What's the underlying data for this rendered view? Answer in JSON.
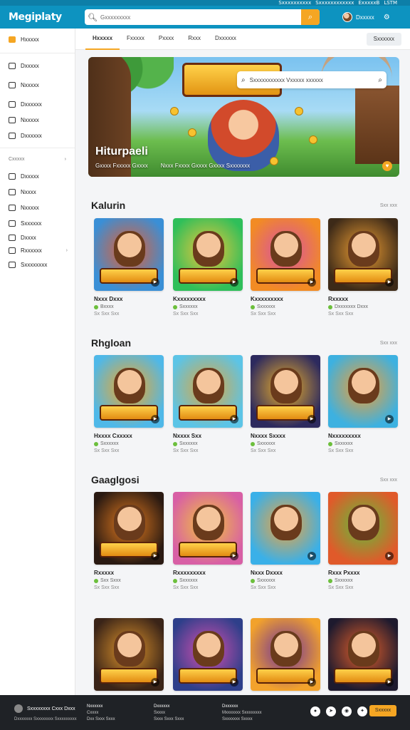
{
  "status": {
    "items": [
      "Sxxxxxxxxxx",
      "Sxxxxxxxxxxxx",
      "ExxxxxB",
      "LSTM"
    ]
  },
  "header": {
    "logo": "Megiplaty",
    "search_placeholder": "Gxxxxxxxxx",
    "user_name": "Dxxxxx"
  },
  "sidebar": {
    "top_items": [
      {
        "label": "Hxxxxx",
        "active": true
      },
      {
        "label": "Dxxxxx"
      },
      {
        "label": "Nxxxxx"
      },
      {
        "label": "Dxxxxxx"
      },
      {
        "label": "Nxxxxx"
      },
      {
        "label": "Dxxxxxx"
      }
    ],
    "section_label": "Cxxxxx",
    "bottom_items": [
      {
        "label": "Dxxxxx"
      },
      {
        "label": "Nxxxx"
      },
      {
        "label": "Nxxxxx"
      },
      {
        "label": "Sxxxxxx"
      },
      {
        "label": "Dxxxx"
      },
      {
        "label": "Rxxxxxx"
      },
      {
        "label": "Sxxxxxxxx"
      }
    ]
  },
  "tabs": {
    "items": [
      "Hxxxxx",
      "Fxxxxx",
      "Pxxxx",
      "Rxxx",
      "Dxxxxxx"
    ],
    "right": "Sxxxxxx"
  },
  "hero": {
    "search_text": "Sxxxxxxxxxxx Vxxxxx xxxxxx",
    "title": "Hiturpaeli",
    "meta": [
      "Gxxxx Fxxxxx Gxxxx",
      "Nxxx Fxxxx Gxxxx Gxxxx Sxxxxxxx"
    ]
  },
  "sections": [
    {
      "title": "Kalurin",
      "more": "Sxx xxx",
      "cards": [
        {
          "name": "Nxxx Dxxx",
          "sub": "Bxxxx",
          "meta": "Sx Sxx Sxx",
          "color1": "#3a8fd6",
          "color2": "#e85d2e",
          "banner": "BEURAN"
        },
        {
          "name": "Kxxxxxxxxx",
          "sub": "Sxxxxxx",
          "meta": "Sx Sxx Sxx",
          "color1": "#2fbf5a",
          "color2": "#f2c53a",
          "banner": "FHRDXUNS"
        },
        {
          "name": "Kxxxxxxxxx",
          "sub": "Sxxxxxx",
          "meta": "Sx Sxx Sxx",
          "color1": "#f28b24",
          "color2": "#d74fa8",
          "banner": "BHCHVRE"
        },
        {
          "name": "Rxxxxx",
          "sub": "Dxxxxxxx Dxxx",
          "meta": "Sx Sxx Sxx",
          "color1": "#3d2a18",
          "color2": "#f2a134",
          "banner": "HHUMRS"
        }
      ]
    },
    {
      "title": "Rhgloan",
      "more": "Sxx xxx",
      "cards": [
        {
          "name": "Hxxxx Cxxxxx",
          "sub": "Sxxxxxx",
          "meta": "Sx Sxx Sxx",
          "color1": "#4fb8e8",
          "color2": "#f5a623",
          "banner": "MESOM"
        },
        {
          "name": "Nxxxx Sxx",
          "sub": "Sxxxxxx",
          "meta": "Sx Sxx Sxx",
          "color1": "#5cc4e6",
          "color2": "#e0a63c",
          "banner": "RUNES"
        },
        {
          "name": "Nxxxx Sxxxx",
          "sub": "Sxxxxxx",
          "meta": "Sx Sxx Sxx",
          "color1": "#2d2a5e",
          "color2": "#f0b229",
          "banner": "PHNERS"
        },
        {
          "name": "Nxxxxxxxxx",
          "sub": "Sxxxxxx",
          "meta": "Sx Sxx Sxx",
          "color1": "#3db1e0",
          "color2": "#f59e30",
          "banner": ""
        }
      ]
    },
    {
      "title": "Gaaglgosi",
      "more": "Sxx xxx",
      "cards": [
        {
          "name": "Rxxxxx",
          "sub": "Sxx Sxxx",
          "meta": "Sx Sxx Sxx",
          "color1": "#2a1a12",
          "color2": "#e67c1f",
          "banner": "EHBBAS"
        },
        {
          "name": "Rxxxxxxxxx",
          "sub": "Sxxxxxx",
          "meta": "Sx Sxx Sxx",
          "color1": "#d85fa5",
          "color2": "#f2c53a",
          "banner": "OHAHENS"
        },
        {
          "name": "Nxxx Dxxxx",
          "sub": "Sxxxxxx",
          "meta": "Sx Sxx Sxx",
          "color1": "#3ab0e8",
          "color2": "#f3a33a",
          "banner": ""
        },
        {
          "name": "Rxxx Pxxxx",
          "sub": "Sxxxxxx",
          "meta": "Sx Sxx Sxx",
          "color1": "#e05a2a",
          "color2": "#5fbf3c",
          "banner": ""
        }
      ]
    },
    {
      "title": "",
      "more": "",
      "cards": [
        {
          "name": "",
          "sub": "",
          "meta": "",
          "color1": "#3a2418",
          "color2": "#e2962c",
          "banner": "BURHIS"
        },
        {
          "name": "",
          "sub": "",
          "meta": "",
          "color1": "#2e3f8a",
          "color2": "#d84fb0",
          "banner": "DETAIRI"
        },
        {
          "name": "",
          "sub": "",
          "meta": "",
          "color1": "#f2a22c",
          "color2": "#6b2f9e",
          "banner": "SHEMUS"
        },
        {
          "name": "",
          "sub": "",
          "meta": "",
          "color1": "#1e1a2e",
          "color2": "#e8612a",
          "banner": "CUVUEE"
        }
      ]
    }
  ],
  "footer": {
    "logo": "Sxxxxxxxx Cxxx Dxxx",
    "tagline": "Dxxxxxxx Sxxxxxxxx Sxxxxxxxxx",
    "cols": [
      [
        "Nxxxxxx",
        "Cxxxx",
        "Dxx Sxxx Sxxx"
      ],
      [
        "Dxxxxxx",
        "Sxxxx",
        "Sxxx Sxxx Sxxx"
      ],
      [
        "Dxxxxxx",
        "Mxxxxxxx Sxxxxxxxx",
        "Sxxxxxxx Sxxxx"
      ]
    ],
    "button": "Sxxxxx"
  }
}
